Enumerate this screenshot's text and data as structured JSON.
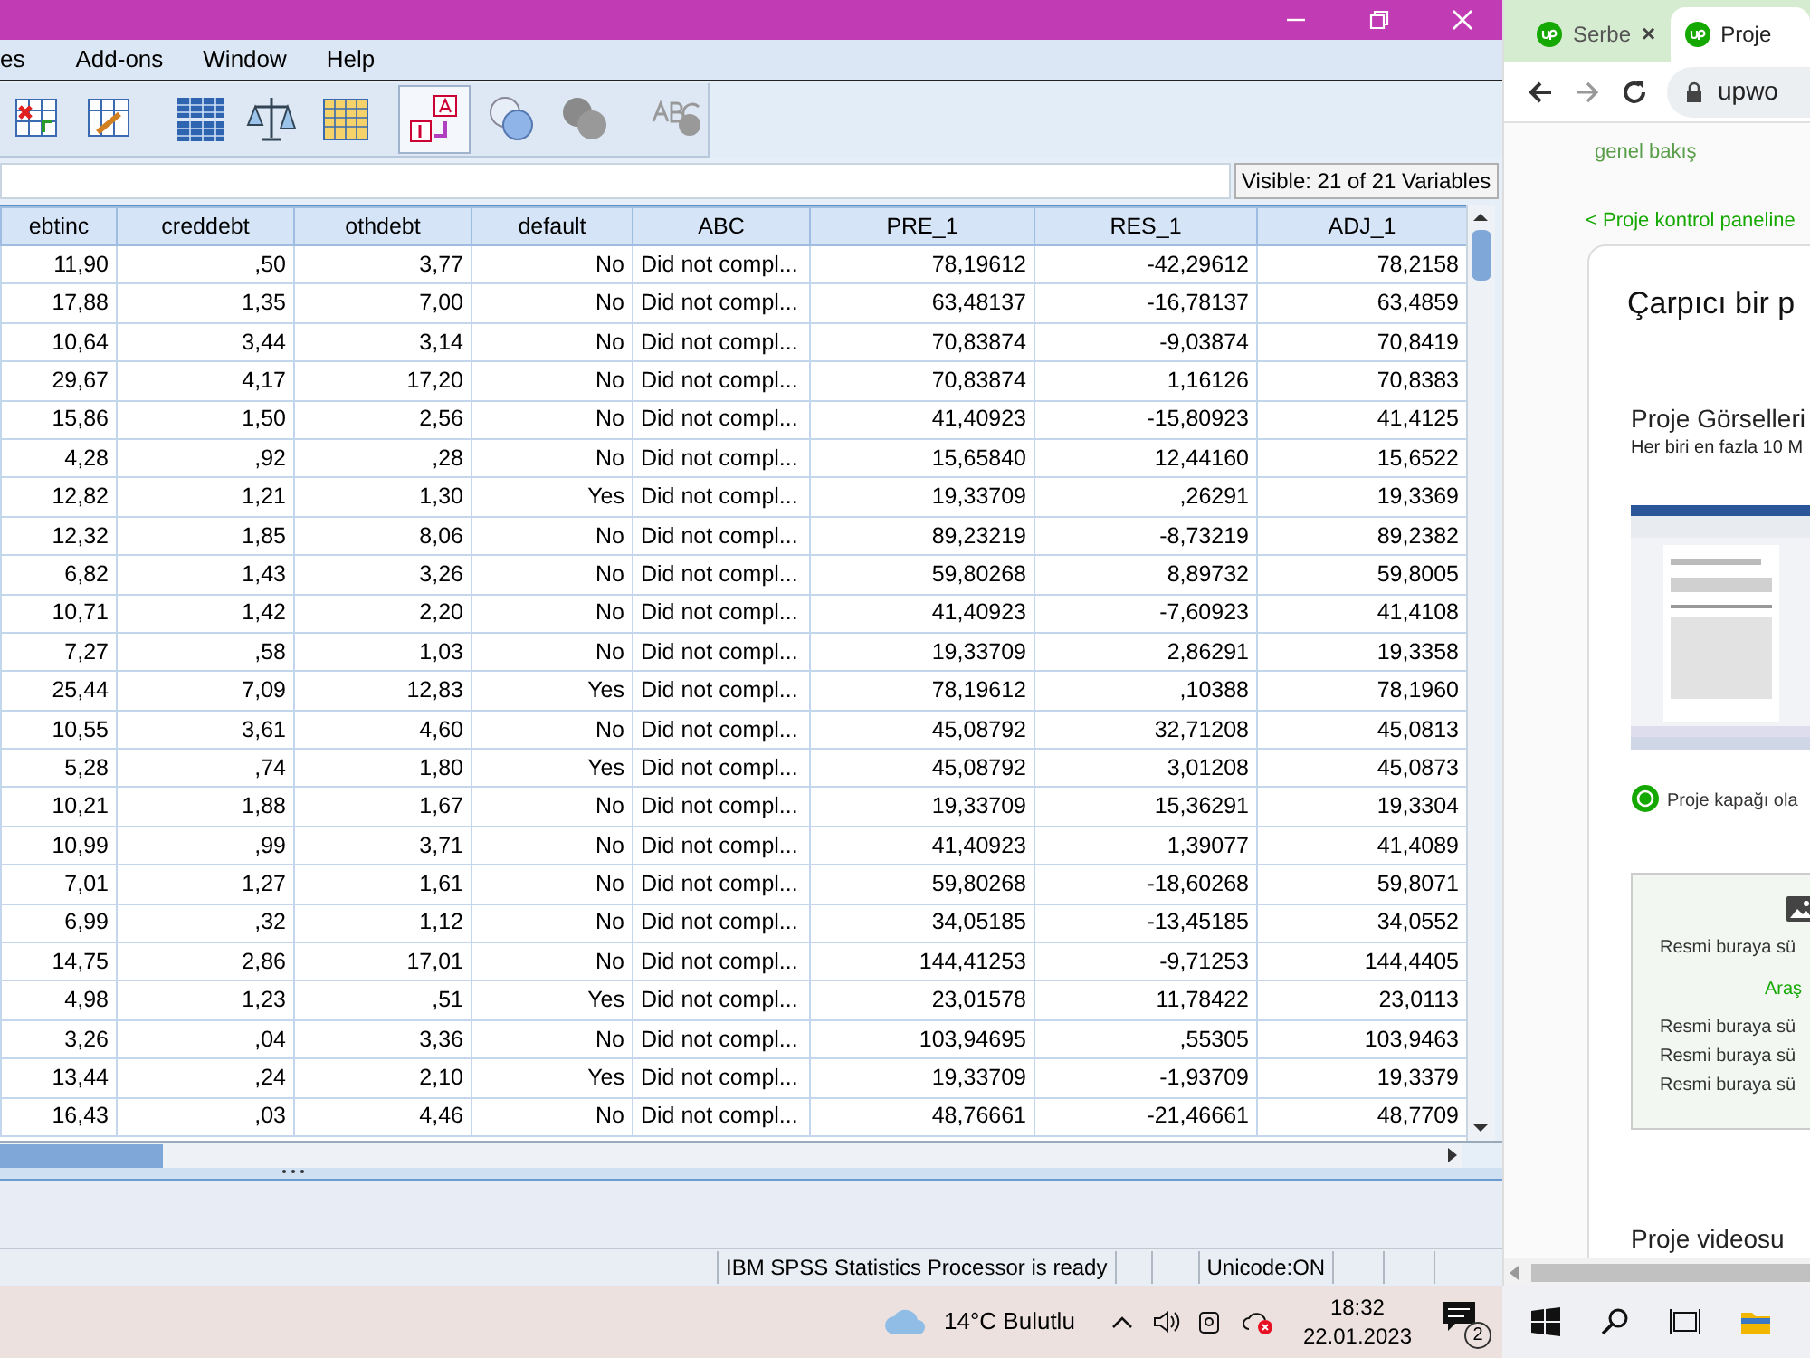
{
  "spss": {
    "menu": [
      "es",
      "Add-ons",
      "Window",
      "Help"
    ],
    "variables_label": "Visible: 21 of 21 Variables",
    "columns": [
      "ebtinc",
      "creddebt",
      "othdebt",
      "default",
      "ABC",
      "PRE_1",
      "RES_1",
      "ADJ_1"
    ],
    "rows": [
      [
        "11,90",
        ",50",
        "3,77",
        "No",
        "Did not compl...",
        "78,19612",
        "-42,29612",
        "78,2158"
      ],
      [
        "17,88",
        "1,35",
        "7,00",
        "No",
        "Did not compl...",
        "63,48137",
        "-16,78137",
        "63,4859"
      ],
      [
        "10,64",
        "3,44",
        "3,14",
        "No",
        "Did not compl...",
        "70,83874",
        "-9,03874",
        "70,8419"
      ],
      [
        "29,67",
        "4,17",
        "17,20",
        "No",
        "Did not compl...",
        "70,83874",
        "1,16126",
        "70,8383"
      ],
      [
        "15,86",
        "1,50",
        "2,56",
        "No",
        "Did not compl...",
        "41,40923",
        "-15,80923",
        "41,4125"
      ],
      [
        "4,28",
        ",92",
        ",28",
        "No",
        "Did not compl...",
        "15,65840",
        "12,44160",
        "15,6522"
      ],
      [
        "12,82",
        "1,21",
        "1,30",
        "Yes",
        "Did not compl...",
        "19,33709",
        ",26291",
        "19,3369"
      ],
      [
        "12,32",
        "1,85",
        "8,06",
        "No",
        "Did not compl...",
        "89,23219",
        "-8,73219",
        "89,2382"
      ],
      [
        "6,82",
        "1,43",
        "3,26",
        "No",
        "Did not compl...",
        "59,80268",
        "8,89732",
        "59,8005"
      ],
      [
        "10,71",
        "1,42",
        "2,20",
        "No",
        "Did not compl...",
        "41,40923",
        "-7,60923",
        "41,4108"
      ],
      [
        "7,27",
        ",58",
        "1,03",
        "No",
        "Did not compl...",
        "19,33709",
        "2,86291",
        "19,3358"
      ],
      [
        "25,44",
        "7,09",
        "12,83",
        "Yes",
        "Did not compl...",
        "78,19612",
        ",10388",
        "78,1960"
      ],
      [
        "10,55",
        "3,61",
        "4,60",
        "No",
        "Did not compl...",
        "45,08792",
        "32,71208",
        "45,0813"
      ],
      [
        "5,28",
        ",74",
        "1,80",
        "Yes",
        "Did not compl...",
        "45,08792",
        "3,01208",
        "45,0873"
      ],
      [
        "10,21",
        "1,88",
        "1,67",
        "No",
        "Did not compl...",
        "19,33709",
        "15,36291",
        "19,3304"
      ],
      [
        "10,99",
        ",99",
        "3,71",
        "No",
        "Did not compl...",
        "41,40923",
        "1,39077",
        "41,4089"
      ],
      [
        "7,01",
        "1,27",
        "1,61",
        "No",
        "Did not compl...",
        "59,80268",
        "-18,60268",
        "59,8071"
      ],
      [
        "6,99",
        ",32",
        "1,12",
        "No",
        "Did not compl...",
        "34,05185",
        "-13,45185",
        "34,0552"
      ],
      [
        "14,75",
        "2,86",
        "17,01",
        "No",
        "Did not compl...",
        "144,41253",
        "-9,71253",
        "144,4405"
      ],
      [
        "4,98",
        "1,23",
        ",51",
        "Yes",
        "Did not compl...",
        "23,01578",
        "11,78422",
        "23,0113"
      ],
      [
        "3,26",
        ",04",
        "3,36",
        "No",
        "Did not compl...",
        "103,94695",
        ",55305",
        "103,9463"
      ],
      [
        "13,44",
        ",24",
        "2,10",
        "Yes",
        "Did not compl...",
        "19,33709",
        "-1,93709",
        "19,3379"
      ],
      [
        "16,43",
        ",03",
        "4,46",
        "No",
        "Did not compl...",
        "48,76661",
        "-21,46661",
        "48,7709"
      ]
    ],
    "status_bar": {
      "message": "IBM SPSS Statistics Processor is ready",
      "unicode": "Unicode:ON"
    }
  },
  "browser": {
    "tabs": [
      {
        "label": "Serbe",
        "selected": false,
        "close": "×"
      },
      {
        "label": "Proje",
        "selected": true
      }
    ],
    "address": "upwo",
    "breadcrumb": "genel bakış",
    "back_link": "< Proje kontrol paneline",
    "card_title": "Çarpıcı bir p",
    "section_title": "Proje Görselleri",
    "section_hint": "Her biri en fazla 10 M",
    "cover_note": "Proje kapağı ola",
    "upload": {
      "drop_text": "Resmi buraya sü",
      "browse": "Araş",
      "lines": [
        "Resmi buraya sü",
        "Resmi buraya sü",
        "Resmi buraya sü"
      ]
    },
    "video_title": "Proje videosu"
  },
  "taskbar": {
    "weather": "14°C Bulutlu",
    "time": "18:32",
    "date": "22.01.2023",
    "notifications": "2"
  }
}
